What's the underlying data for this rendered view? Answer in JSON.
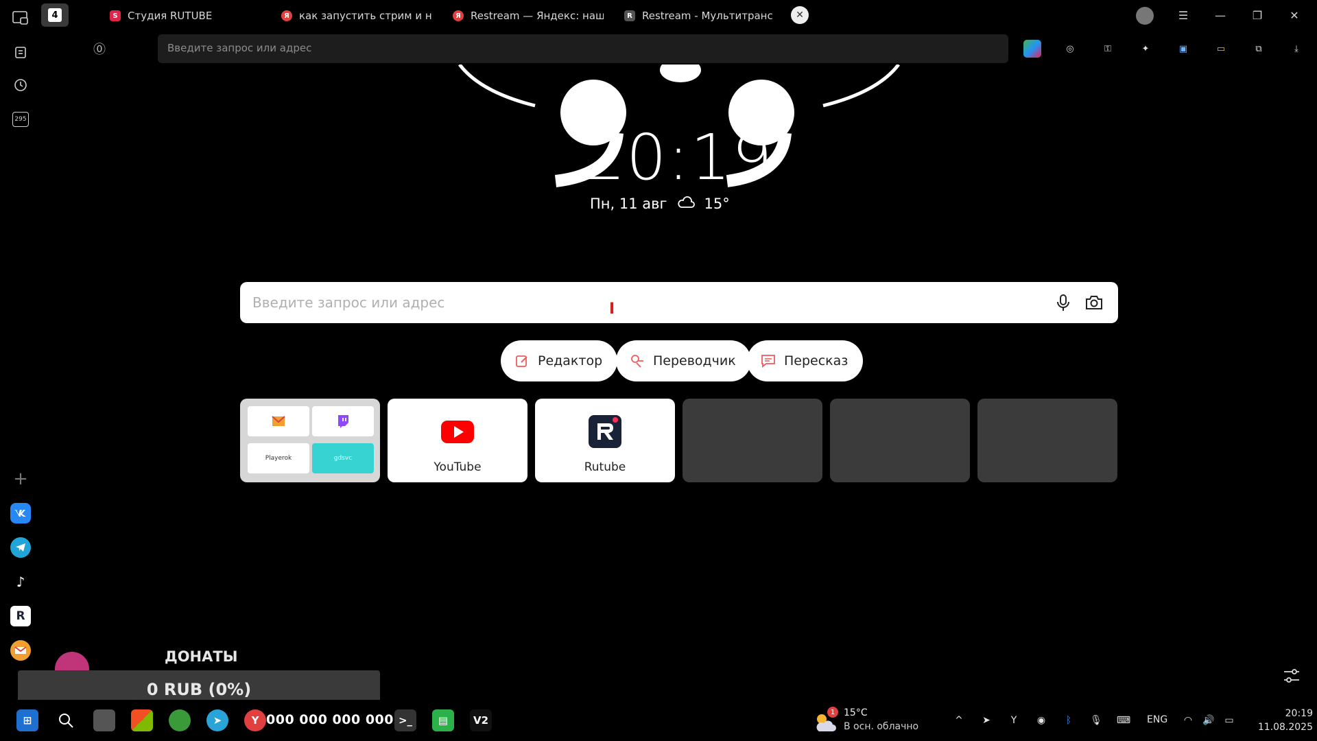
{
  "tabs": [
    {
      "id": "tab-counter",
      "label": "4"
    },
    {
      "id": "tab-rutube-studio",
      "label": "Студия RUTUBE",
      "favicon_color": "#e1254a"
    },
    {
      "id": "tab-search-stream",
      "label": "как запустить стрим и н",
      "favicon_color": "#e14040"
    },
    {
      "id": "tab-restream",
      "label": "Restream — Яндекс: наш",
      "favicon_color": "#e14040"
    },
    {
      "id": "tab-restream-multi",
      "label": "Restream - Мультитранс",
      "favicon_color": "#888888"
    }
  ],
  "address_bar": {
    "text": "Введите запрос или адрес"
  },
  "sidebar": {
    "badge": "295",
    "apps": [
      "vk",
      "telegram",
      "tiktok",
      "rutube",
      "mail"
    ]
  },
  "clock": {
    "time": "20:19",
    "date": "Пн, 11 авг",
    "weather": "15°"
  },
  "search": {
    "placeholder": "Введите запрос или адрес"
  },
  "pills": [
    {
      "id": "editor",
      "label": "Редактор"
    },
    {
      "id": "translator",
      "label": "Переводчик"
    },
    {
      "id": "retell",
      "label": "Пересказ"
    }
  ],
  "tiles": {
    "folder": {
      "items": [
        "mail",
        "twitch",
        "Playerok",
        "gdsvc"
      ]
    },
    "youtube": {
      "label": "YouTube",
      "color": "#ff0000"
    },
    "rutube": {
      "label": "Rutube",
      "color": "#1a2238"
    }
  },
  "donations": {
    "title": "ДОНАТЫ",
    "amount": "0 RUB (0%)"
  },
  "taskbar": {
    "counter": "000 000 000 000",
    "weather_temp": "15°C",
    "weather_desc": "В осн. облачно",
    "weather_badge": "1",
    "lang": "ENG",
    "time": "20:19",
    "date": "11.08.2025"
  },
  "colors": {
    "accent": "#f05a5a",
    "background": "#000000",
    "tile_grey": "#3b3b3b"
  }
}
